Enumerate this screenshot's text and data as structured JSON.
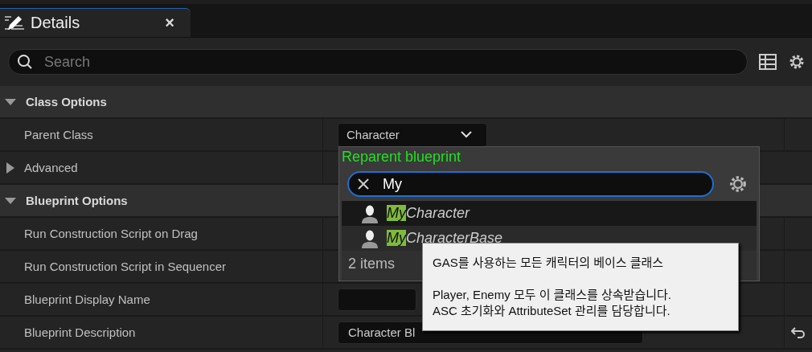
{
  "tab": {
    "title": "Details",
    "close": "×"
  },
  "search": {
    "placeholder": "Search"
  },
  "sections": [
    {
      "title": "Class Options",
      "expanded": true,
      "rows": [
        {
          "kind": "dropdown",
          "label": "Parent Class",
          "value": "Character"
        },
        {
          "kind": "group",
          "label": "Advanced",
          "expanded": false
        }
      ]
    },
    {
      "title": "Blueprint Options",
      "expanded": true,
      "rows": [
        {
          "kind": "blank",
          "label": "Run Construction Script on Drag"
        },
        {
          "kind": "blank",
          "label": "Run Construction Script in Sequencer"
        },
        {
          "kind": "field",
          "label": "Blueprint Display Name",
          "value": ""
        },
        {
          "kind": "field",
          "label": "Blueprint Description",
          "value": "Character Bl",
          "resettable": true
        }
      ]
    }
  ],
  "popup": {
    "title": "Reparent blueprint",
    "query": "My",
    "items": [
      {
        "match": "My",
        "rest": "Character",
        "selected": true
      },
      {
        "match": "My",
        "rest": "CharacterBase",
        "selected": false
      }
    ],
    "count": "2 items"
  },
  "tooltip": {
    "paragraphs": [
      [
        "GAS를 사용하는 모든 캐릭터의 베이스 클래스"
      ],
      [
        "Player, Enemy 모두 이 클래스를 상속받습니다.",
        "ASC 초기화와 AttributeSet 관리를 담당합니다."
      ]
    ]
  }
}
